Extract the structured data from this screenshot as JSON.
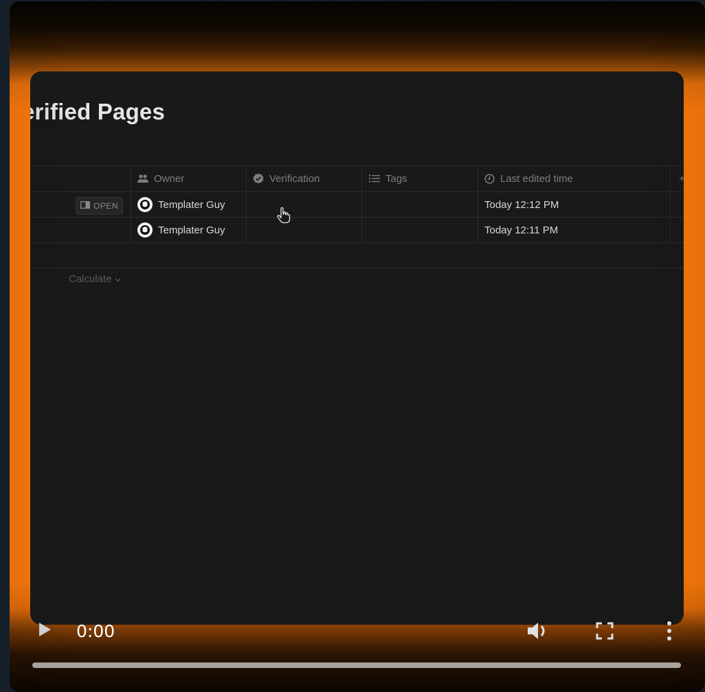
{
  "page": {
    "title": "erified Pages"
  },
  "table": {
    "columns": [
      {
        "label": "Owner",
        "icon": "people-icon"
      },
      {
        "label": "Verification",
        "icon": "verified-badge-icon"
      },
      {
        "label": "Tags",
        "icon": "list-icon"
      },
      {
        "label": "Last edited time",
        "icon": "clock-icon"
      }
    ],
    "open_label": "OPEN",
    "rows": [
      {
        "owner": "Templater Guy",
        "last_edited": "Today 12:12 PM"
      },
      {
        "owner": "Templater Guy",
        "last_edited": "Today 12:11 PM"
      }
    ],
    "calculate_label": "Calculate",
    "add_column_label": "+"
  },
  "player": {
    "time": "0:00",
    "progress": 0,
    "accent_color": "#fb7a0c"
  }
}
